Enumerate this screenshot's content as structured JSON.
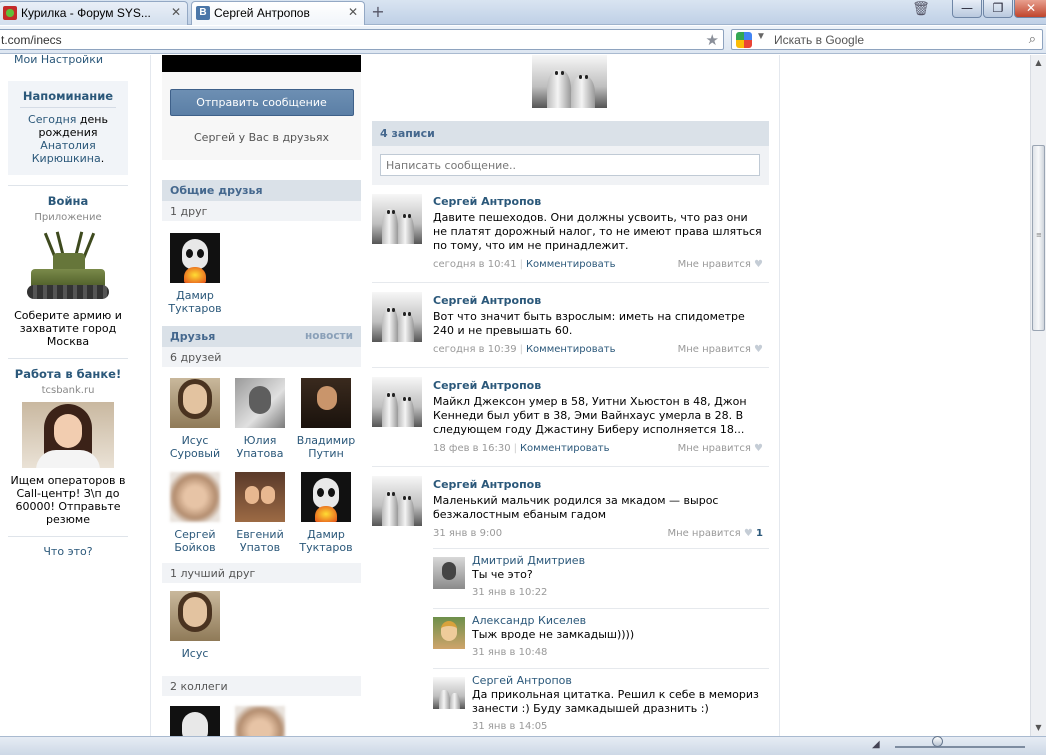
{
  "browser": {
    "tabs": [
      {
        "label": "Курилка - Форум SYS...",
        "active": false
      },
      {
        "label": "Сергей Антропов",
        "active": true
      }
    ],
    "url": "t.com/inecs",
    "search_placeholder": "Искать в Google",
    "window_controls": {
      "minimize": "—",
      "restore": "❐",
      "close": "✕"
    }
  },
  "left_menu": {
    "settings": "Мои Настройки",
    "reminder": {
      "title": "Напоминание",
      "today": "Сегодня",
      "text_mid": " день рождения ",
      "person": "Анатолия Кирюшкина",
      "end": "."
    },
    "app": {
      "title": "Война",
      "subtitle": "Приложение",
      "description": "Соберите армию и захватите город Москва"
    },
    "ad": {
      "title": "Работа в банке!",
      "domain": "tcsbank.ru",
      "description": "Ищем операторов в Call-центр! З\\п до 60000! Отправьте резюме"
    },
    "what_is": "Что это?"
  },
  "profile": {
    "send_message": "Отправить сообщение",
    "in_friends": "Сергей у Вас в друзьях",
    "mutual": {
      "title": "Общие друзья",
      "count": "1 друг",
      "items": [
        {
          "name": "Дамир Туктаров",
          "avatar": "alien"
        }
      ]
    },
    "friends": {
      "title": "Друзья",
      "news": "новости",
      "count": "6 друзей",
      "items": [
        {
          "name": "Исус Суровый",
          "avatar": "hairy"
        },
        {
          "name": "Юлия Упатова",
          "avatar": "bw"
        },
        {
          "name": "Владимир Путин",
          "avatar": "dark"
        },
        {
          "name": "Сергей Бойков",
          "avatar": "blurry"
        },
        {
          "name": "Евгений Упатов",
          "avatar": "couple"
        },
        {
          "name": "Дамир Туктаров",
          "avatar": "alien"
        }
      ]
    },
    "best": {
      "count": "1 лучший друг",
      "items": [
        {
          "name": "Исус",
          "avatar": "hairy"
        }
      ]
    },
    "colleagues": {
      "count": "2 коллеги"
    }
  },
  "wall": {
    "count": "4 записи",
    "input_placeholder": "Написать сообщение..",
    "posts": [
      {
        "author": "Сергей Антропов",
        "text": "Давите пешеходов. Они должны усвоить, что раз они не платят дорожный налог, то не имеют права шляться по тому, что им не принадлежит.",
        "time": "сегодня в 10:41",
        "comment": "Комментировать",
        "like": "Мне нравится",
        "likes": ""
      },
      {
        "author": "Сергей Антропов",
        "text": "Вот что значит быть взрослым: иметь на спидометре 240 и не превышать 60.",
        "time": "сегодня в 10:39",
        "comment": "Комментировать",
        "like": "Мне нравится",
        "likes": ""
      },
      {
        "author": "Сергей Антропов",
        "text": "Майкл Джексон умер в 58, Уитни Хьюстон в 48, Джон Кеннеди был убит в 38, Эми Вайнхаус умерла в 28. В следующем году Джастину Биберу исполняется 18...",
        "time": "18 фев в 16:30",
        "comment": "Комментировать",
        "like": "Мне нравится",
        "likes": ""
      },
      {
        "author": "Сергей Антропов",
        "text": "Маленький мальчик родился за мкадом — вырос безжалостным ебаным гадом",
        "time": "31 янв в 9:00",
        "comment": "",
        "like": "Мне нравится",
        "likes": "1"
      }
    ],
    "replies": [
      {
        "name": "Дмитрий Дмитриев",
        "text": "Ты че это?",
        "time": "31 янв в 10:22",
        "avatar": "dima"
      },
      {
        "name": "Александр Киселев",
        "text": "Тыж вроде не замкадыш))))",
        "time": "31 янв в 10:48",
        "avatar": "alex"
      },
      {
        "name": "Сергей Антропов",
        "text": "Да прикольная цитатка. Решил к себе в мемориз занести :) Буду замкадышей дразнить :)",
        "time": "31 янв в 14:05",
        "avatar": "fingers"
      }
    ]
  },
  "colors": {
    "link": "#2B587A",
    "section_header": "#DAE1E8",
    "button": "#5B7FA6"
  }
}
